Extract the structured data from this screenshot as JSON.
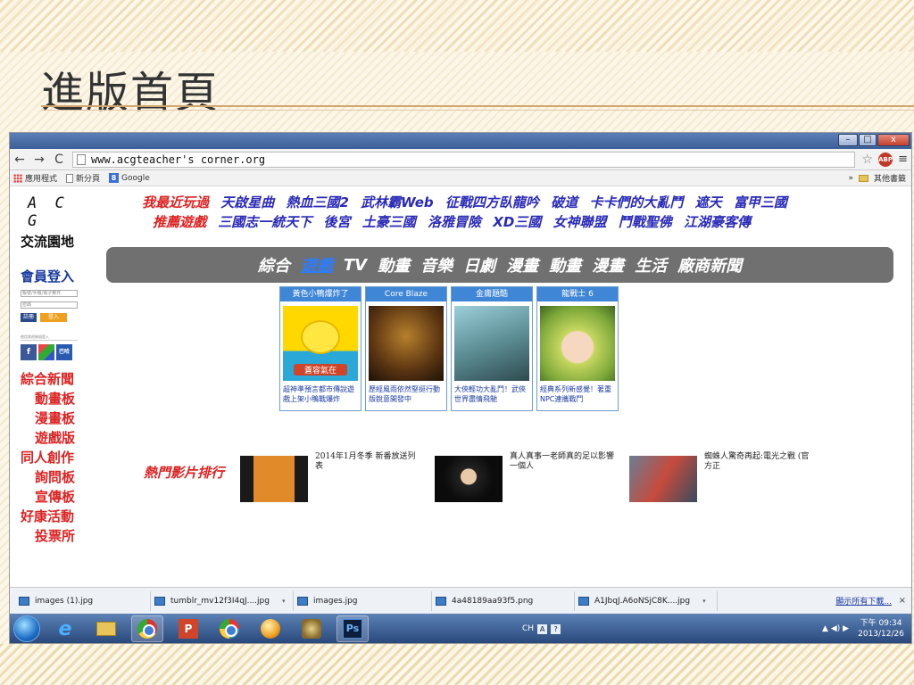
{
  "slide": {
    "title": "進版首頁"
  },
  "browser": {
    "url": "www.acgteacher's corner.org",
    "window_controls": {
      "minimize": "–",
      "maximize": "□",
      "close": "x"
    },
    "nav": {
      "back": "←",
      "forward": "→",
      "reload": "C"
    },
    "bookmarks": [
      {
        "label": "應用程式",
        "icon": "apps-icon"
      },
      {
        "label": "新分頁",
        "icon": "page-icon"
      },
      {
        "label": "Google",
        "icon": "google-icon"
      }
    ],
    "bookmarks_more": "»",
    "other_bookmarks": "其他書籤",
    "star": "☆",
    "abp": "ABP",
    "menu": "≡"
  },
  "site": {
    "logo": "A C G",
    "logo_sub": "交流園地",
    "login": {
      "title": "會員登入",
      "username_placeholder": "帳號/手機/電子郵件",
      "password_placeholder": "密碼",
      "register": "註冊",
      "login": "登入",
      "social_note": "使用其他帳號登入"
    },
    "social": {
      "facebook": "f",
      "gplus": "",
      "bahamut": "巴哈"
    },
    "side_menu": [
      {
        "label": "綜合新聞",
        "indent": false
      },
      {
        "label": "動畫板",
        "indent": true
      },
      {
        "label": "漫畫板",
        "indent": true
      },
      {
        "label": "遊戲版",
        "indent": true
      },
      {
        "label": "同人創作",
        "indent": false
      },
      {
        "label": "詢問板",
        "indent": true
      },
      {
        "label": "宣傳板",
        "indent": true
      },
      {
        "label": "好康活動",
        "indent": false
      },
      {
        "label": "投票所",
        "indent": true
      }
    ],
    "recent_label": "我最近玩過",
    "recent_games": [
      "天啟星曲",
      "熱血三國2",
      "武林霸Web",
      "征戰四方臥龍吟",
      "破道",
      "卡卡們的大亂鬥",
      "遮天",
      "富甲三國"
    ],
    "recommend_label": "推薦遊戲",
    "recommend_games": [
      "三國志一統天下",
      "後宮",
      "土豪三國",
      "洛雅冒險",
      "XD三國",
      "女神聯盟",
      "鬥戰聖佛",
      "江湖豪客傳"
    ],
    "categories": [
      {
        "label": "綜合",
        "active": false
      },
      {
        "label": "遊戲",
        "active": true
      },
      {
        "label": "TV",
        "active": false
      },
      {
        "label": "動畫",
        "active": false
      },
      {
        "label": "音樂",
        "active": false
      },
      {
        "label": "日劇",
        "active": false
      },
      {
        "label": "漫畫",
        "active": false
      },
      {
        "label": "動畫",
        "active": false
      },
      {
        "label": "漫畫",
        "active": false
      },
      {
        "label": "生活",
        "active": false
      },
      {
        "label": "廠商新聞",
        "active": false
      }
    ],
    "cards": [
      {
        "title": "黃色小鴨爆炸了",
        "desc": "超神準預言都市傳說遊戲上架小鴨戰爆炸",
        "badge": "蒼容氣在",
        "img": "duck"
      },
      {
        "title": "Core Blaze",
        "desc": "歷經風雨依然堅挺行動版銳意開發中",
        "img": "blaze"
      },
      {
        "title": "金庸題酷",
        "desc": "大俠輕功大亂鬥！武俠世界盡情飛馳",
        "img": "run"
      },
      {
        "title": "龍戰士 6",
        "desc": "經典系列新感覺！著重NPC連攜戰鬥",
        "img": "anime"
      }
    ],
    "hot_videos_label": "熱門影片排行",
    "videos": [
      {
        "text": "2014年1月冬季 新番放送列表",
        "thumb": "th1"
      },
      {
        "text": "真人真事一老師真的足以影響一個人",
        "thumb": "th2"
      },
      {
        "text": "蜘蛛人驚奇再起:電光之戰 (官方正",
        "thumb": "th3"
      }
    ]
  },
  "downloads": {
    "items": [
      "images (1).jpg",
      "tumblr_mv12f3I4qJ....jpg",
      "images.jpg",
      "4a48189aa93f5.png",
      "A1JbqJ.A6oNSjC8K....jpg"
    ],
    "show_all": "顯示所有下載...",
    "close": "×"
  },
  "taskbar": {
    "ime": [
      "CH",
      "A",
      "?"
    ],
    "tray": "▲ ◀) ▶",
    "time": "下午 09:34",
    "date": "2013/12/26"
  }
}
